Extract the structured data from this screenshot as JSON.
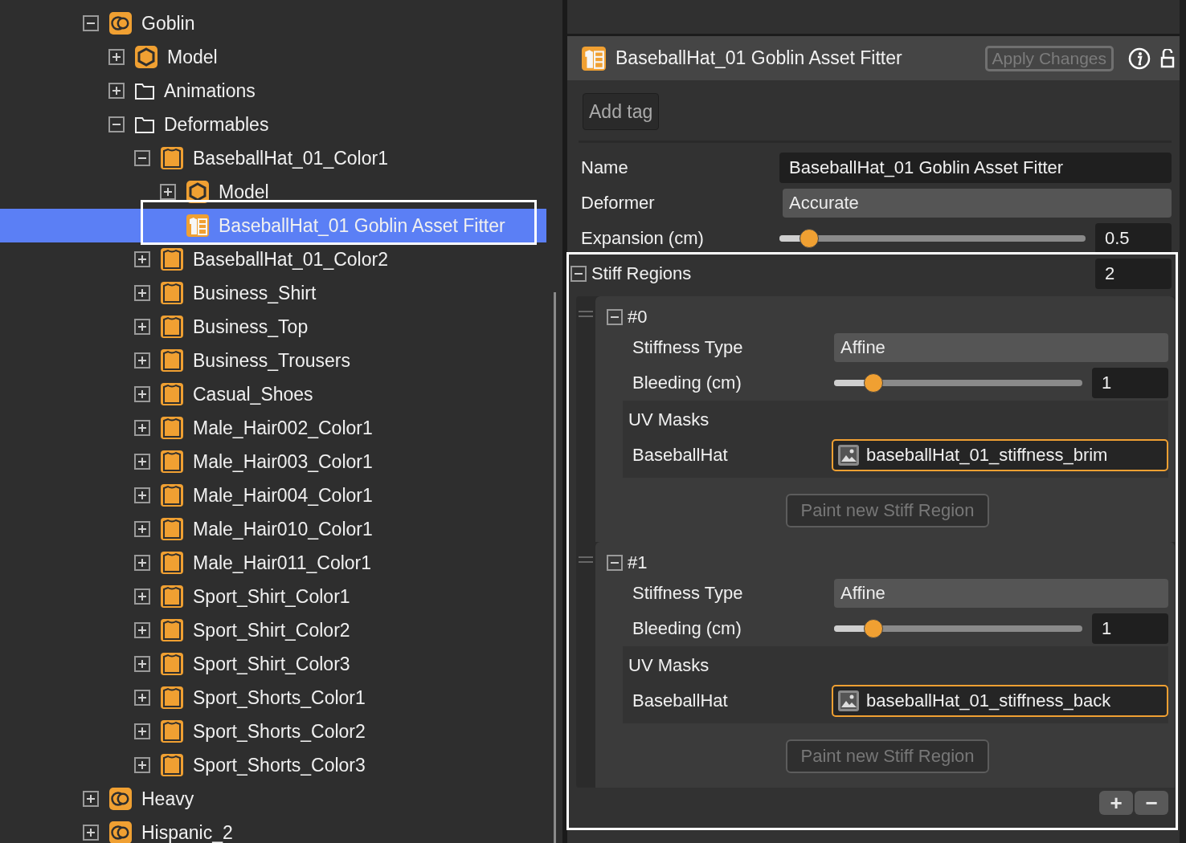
{
  "tree": [
    {
      "label": "Goblin",
      "kind": "character",
      "expanded": true,
      "selected": false,
      "children": [
        {
          "label": "Model",
          "kind": "model",
          "expanded": false,
          "selected": false
        },
        {
          "label": "Animations",
          "kind": "folder",
          "expanded": false,
          "selected": false
        },
        {
          "label": "Deformables",
          "kind": "folder",
          "expanded": true,
          "selected": false,
          "children": [
            {
              "label": "BaseballHat_01_Color1",
              "kind": "clothing",
              "expanded": true,
              "selected": false,
              "children": [
                {
                  "label": "Model",
                  "kind": "model",
                  "expanded": false,
                  "selected": false
                },
                {
                  "label": "BaseballHat_01 Goblin Asset Fitter",
                  "kind": "fitter",
                  "selected": true
                }
              ]
            },
            {
              "label": "BaseballHat_01_Color2",
              "kind": "clothing",
              "expanded": false,
              "selected": false
            },
            {
              "label": "Business_Shirt",
              "kind": "clothing",
              "expanded": false,
              "selected": false
            },
            {
              "label": "Business_Top",
              "kind": "clothing",
              "expanded": false,
              "selected": false
            },
            {
              "label": "Business_Trousers",
              "kind": "clothing",
              "expanded": false,
              "selected": false
            },
            {
              "label": "Casual_Shoes",
              "kind": "clothing",
              "expanded": false,
              "selected": false
            },
            {
              "label": "Male_Hair002_Color1",
              "kind": "clothing",
              "expanded": false,
              "selected": false
            },
            {
              "label": "Male_Hair003_Color1",
              "kind": "clothing",
              "expanded": false,
              "selected": false
            },
            {
              "label": "Male_Hair004_Color1",
              "kind": "clothing",
              "expanded": false,
              "selected": false
            },
            {
              "label": "Male_Hair010_Color1",
              "kind": "clothing",
              "expanded": false,
              "selected": false
            },
            {
              "label": "Male_Hair011_Color1",
              "kind": "clothing",
              "expanded": false,
              "selected": false
            },
            {
              "label": "Sport_Shirt_Color1",
              "kind": "clothing",
              "expanded": false,
              "selected": false
            },
            {
              "label": "Sport_Shirt_Color2",
              "kind": "clothing",
              "expanded": false,
              "selected": false
            },
            {
              "label": "Sport_Shirt_Color3",
              "kind": "clothing",
              "expanded": false,
              "selected": false
            },
            {
              "label": "Sport_Shorts_Color1",
              "kind": "clothing",
              "expanded": false,
              "selected": false
            },
            {
              "label": "Sport_Shorts_Color2",
              "kind": "clothing",
              "expanded": false,
              "selected": false
            },
            {
              "label": "Sport_Shorts_Color3",
              "kind": "clothing",
              "expanded": false,
              "selected": false
            }
          ]
        }
      ]
    },
    {
      "label": "Heavy",
      "kind": "character",
      "expanded": false,
      "selected": false
    },
    {
      "label": "Hispanic_2",
      "kind": "character",
      "expanded": false,
      "selected": false
    }
  ],
  "inspector": {
    "title": "BaseballHat_01 Goblin Asset Fitter",
    "apply_button": {
      "label": "Apply Changes",
      "disabled": true
    },
    "add_tag_button": "Add tag",
    "fields": [
      {
        "kind": "text",
        "label": "Name",
        "value": "BaseballHat_01 Goblin Asset Fitter"
      },
      {
        "kind": "dropdown",
        "label": "Deformer",
        "value": "Accurate"
      },
      {
        "kind": "slider",
        "label": "Expansion (cm)",
        "level": 0.07,
        "value": "0.5"
      }
    ],
    "stiff_regions": {
      "label": "Stiff Regions",
      "expanded": true,
      "count": "2",
      "items": [
        {
          "index": "#0",
          "expanded": true,
          "fields": [
            {
              "kind": "dropdown",
              "label": "Stiffness Type",
              "value": "Affine"
            },
            {
              "kind": "slider",
              "label": "Bleeding (cm)",
              "level": 0.13,
              "value": "1"
            }
          ],
          "uv_masks": {
            "label": "UV Masks",
            "entries": [
              {
                "label": "BaseballHat",
                "value": "baseballHat_01_stiffness_brim"
              }
            ]
          },
          "paint_button": {
            "label": "Paint new Stiff Region",
            "disabled": true
          }
        },
        {
          "index": "#1",
          "expanded": true,
          "fields": [
            {
              "kind": "dropdown",
              "label": "Stiffness Type",
              "value": "Affine"
            },
            {
              "kind": "slider",
              "label": "Bleeding (cm)",
              "level": 0.13,
              "value": "1"
            }
          ],
          "uv_masks": {
            "label": "UV Masks",
            "entries": [
              {
                "label": "BaseballHat",
                "value": "baseballHat_01_stiffness_back"
              }
            ]
          },
          "paint_button": {
            "label": "Paint new Stiff Region",
            "disabled": true
          }
        }
      ],
      "footer_buttons": [
        "+",
        "−"
      ]
    }
  }
}
